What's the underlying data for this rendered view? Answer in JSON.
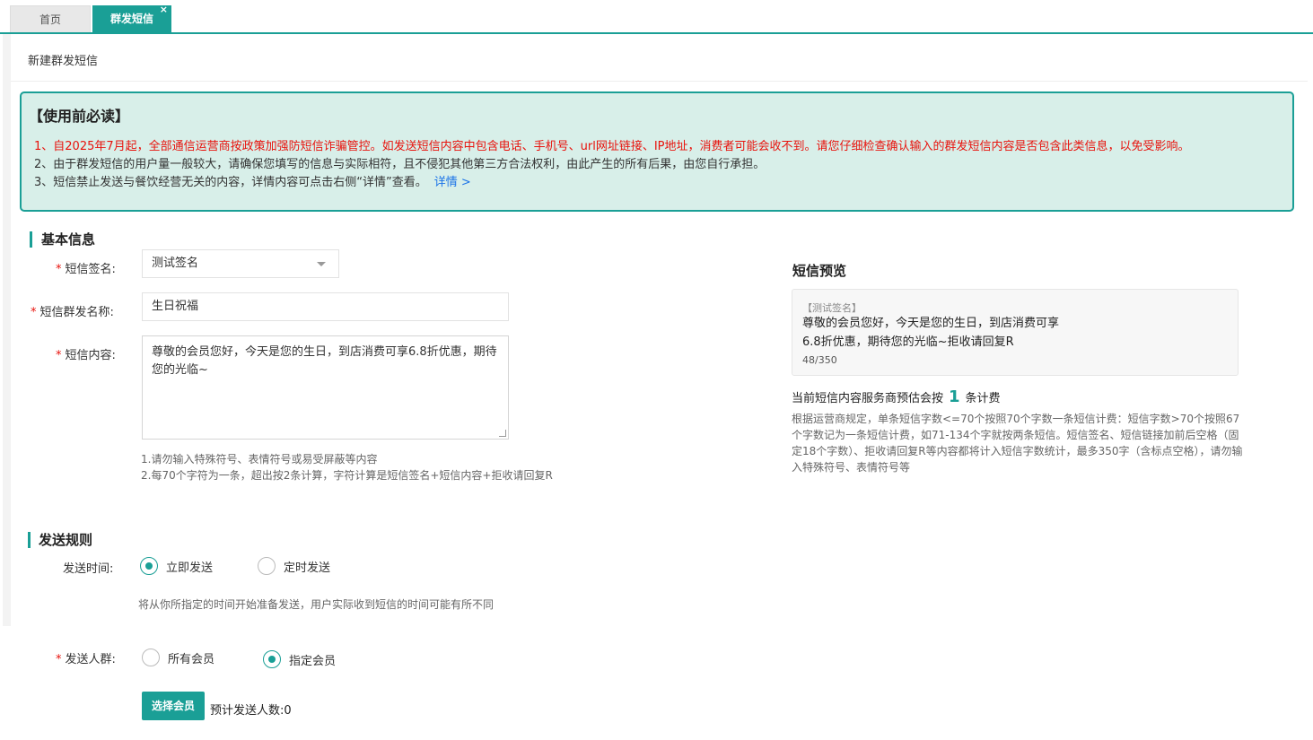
{
  "tabs": {
    "home": "首页",
    "active": "群发短信",
    "close": "×"
  },
  "page_title": "新建群发短信",
  "notice": {
    "title": "【使用前必读】",
    "line1": "1、自2025年7月起，全部通信运营商按政策加强防短信诈骗管控。如发送短信内容中包含电话、手机号、url网址链接、IP地址，消费者可能会收不到。请您仔细检查确认输入的群发短信内容是否包含此类信息，以免受影响。",
    "line2": "2、由于群发短信的用户量一般较大，请确保您填写的信息与实际相符，且不侵犯其他第三方合法权利，由此产生的所有后果，由您自行承担。",
    "line3": "3、短信禁止发送与餐饮经营无关的内容，详情内容可点击右侧“详情”查看。",
    "link": "详情 >"
  },
  "basic": {
    "section": "基本信息",
    "required_mark": "*",
    "signature_label": "短信签名:",
    "signature_value": "测试签名",
    "name_label": "短信群发名称:",
    "name_value": "生日祝福",
    "content_label": "短信内容:",
    "content_value": "尊敬的会员您好，今天是您的生日，到店消费可享6.8折优惠，期待您的光临~",
    "hint1": "1.请勿输入特殊符号、表情符号或易受屏蔽等内容",
    "hint2": "2.每70个字符为一条，超出按2条计算，字符计算是短信签名+短信内容+拒收请回复R"
  },
  "preview": {
    "title": "短信预览",
    "signature": "【测试签名】",
    "text": "尊敬的会员您好，今天是您的生日，到店消费可享6.8折优惠，期待您的光临~拒收请回复R",
    "count": "48/350",
    "fee_prefix": "当前短信内容服务商预估会按",
    "fee_num": "1",
    "fee_suffix": "条计费",
    "fee_desc": "根据运营商规定，单条短信字数<=70个按照70个字数一条短信计费：短信字数>70个按照67个字数记为一条短信计费，如71-134个字就按两条短信。短信签名、短信链接加前后空格（固定18个字数）、拒收请回复R等内容都将计入短信字数统计，最多350字（含标点空格），请勿输入特殊符号、表情符号等"
  },
  "rules": {
    "section": "发送规则",
    "time_label": "发送时间:",
    "time_now": "立即发送",
    "time_scheduled": "定时发送",
    "time_selected": "now",
    "time_hint": "将从你所指定的时间开始准备发送，用户实际收到短信的时间可能有所不同",
    "audience_label": "发送人群:",
    "audience_all": "所有会员",
    "audience_specified": "指定会员",
    "audience_selected": "specified",
    "select_button": "选择会员",
    "estimate_label": "预计发送人数:",
    "estimate_value": "0"
  },
  "colors": {
    "accent": "#1a9f96",
    "warning": "#e8120c",
    "link": "#1a73e8"
  }
}
